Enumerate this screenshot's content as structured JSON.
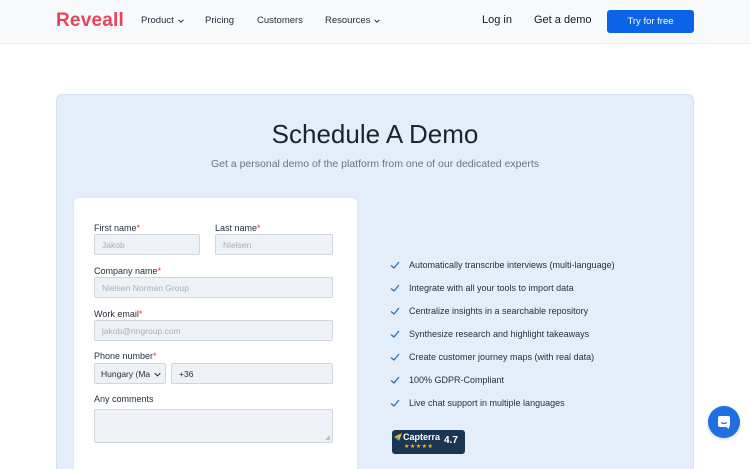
{
  "nav": {
    "logo": "Reveall",
    "items": [
      "Product",
      "Pricing",
      "Customers",
      "Resources"
    ],
    "login": "Log in",
    "get_demo": "Get a demo",
    "try_free": "Try for free"
  },
  "hero": {
    "title": "Schedule A Demo",
    "subtitle": "Get a personal demo of the platform from one of our dedicated experts"
  },
  "form": {
    "first_name_label": "First name",
    "first_name_placeholder": "Jakob",
    "last_name_label": "Last name",
    "last_name_placeholder": "Nielsen",
    "company_label": "Company name",
    "company_placeholder": "Nielsen Norman Group",
    "email_label": "Work email",
    "email_placeholder": "jakob@nngroup.com",
    "phone_label": "Phone number",
    "country_value": "Hungary (Ma",
    "phone_prefix": "+36",
    "comments_label": "Any comments",
    "required_mark": "*"
  },
  "features": [
    "Automatically transcribe interviews (multi-language)",
    "Integrate with all your tools to import data",
    "Centralize insights in a searchable repository",
    "Synthesize research and highlight takeaways",
    "Create customer journey maps (with real data)",
    "100% GDPR-Compliant",
    "Live chat support in multiple languages"
  ],
  "badge": {
    "name": "Capterra",
    "stars": "★★★★★",
    "score": "4.7"
  },
  "colors": {
    "brand": "#e8435a",
    "primary": "#0b63e5",
    "panel": "#e4eefb",
    "check": "#2a6fb0"
  },
  "icons": {
    "chevron": "chevron-down-icon",
    "check": "check-icon",
    "chat": "chat-bubble-icon"
  }
}
